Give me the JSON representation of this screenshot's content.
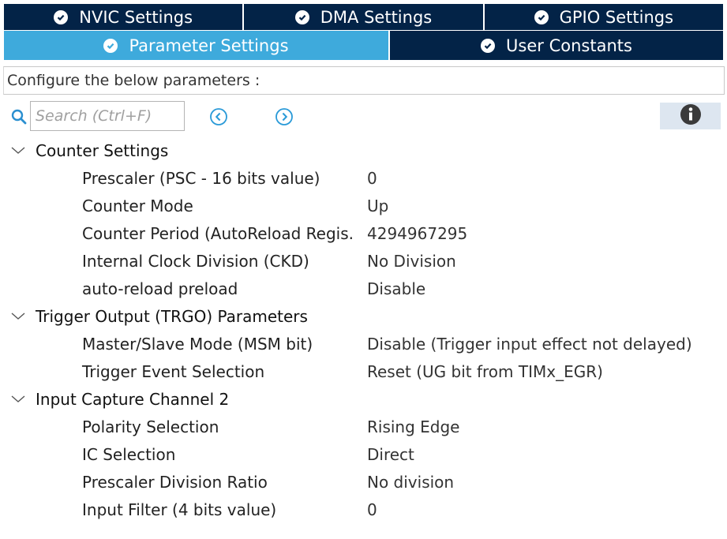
{
  "tabs_row1": [
    {
      "label": "NVIC Settings"
    },
    {
      "label": "DMA Settings"
    },
    {
      "label": "GPIO Settings"
    }
  ],
  "tabs_row2": [
    {
      "label": "Parameter Settings",
      "active": true
    },
    {
      "label": "User Constants"
    }
  ],
  "config_text": "Configure the below parameters :",
  "search": {
    "placeholder": "Search (Ctrl+F)",
    "value": ""
  },
  "colors": {
    "tab_dark": "#032347",
    "tab_active": "#3eaadc",
    "info_bg": "#dde6f0"
  },
  "groups": [
    {
      "title": "Counter Settings",
      "params": [
        {
          "name": "Prescaler (PSC - 16 bits value)",
          "value": "0"
        },
        {
          "name": "Counter Mode",
          "value": "Up"
        },
        {
          "name": "Counter Period (AutoReload Regis.",
          "value": "4294967295"
        },
        {
          "name": "Internal Clock Division (CKD)",
          "value": "No Division"
        },
        {
          "name": "auto-reload preload",
          "value": "Disable"
        }
      ]
    },
    {
      "title": "Trigger Output (TRGO) Parameters",
      "params": [
        {
          "name": "Master/Slave Mode (MSM bit)",
          "value": "Disable (Trigger input effect not delayed)"
        },
        {
          "name": "Trigger Event Selection",
          "value": "Reset (UG bit from TIMx_EGR)"
        }
      ]
    },
    {
      "title": "Input Capture Channel 2",
      "params": [
        {
          "name": "Polarity Selection",
          "value": "Rising Edge"
        },
        {
          "name": "IC Selection",
          "value": "Direct"
        },
        {
          "name": "Prescaler Division Ratio",
          "value": "No division"
        },
        {
          "name": "Input Filter (4 bits value)",
          "value": "0"
        }
      ]
    }
  ]
}
